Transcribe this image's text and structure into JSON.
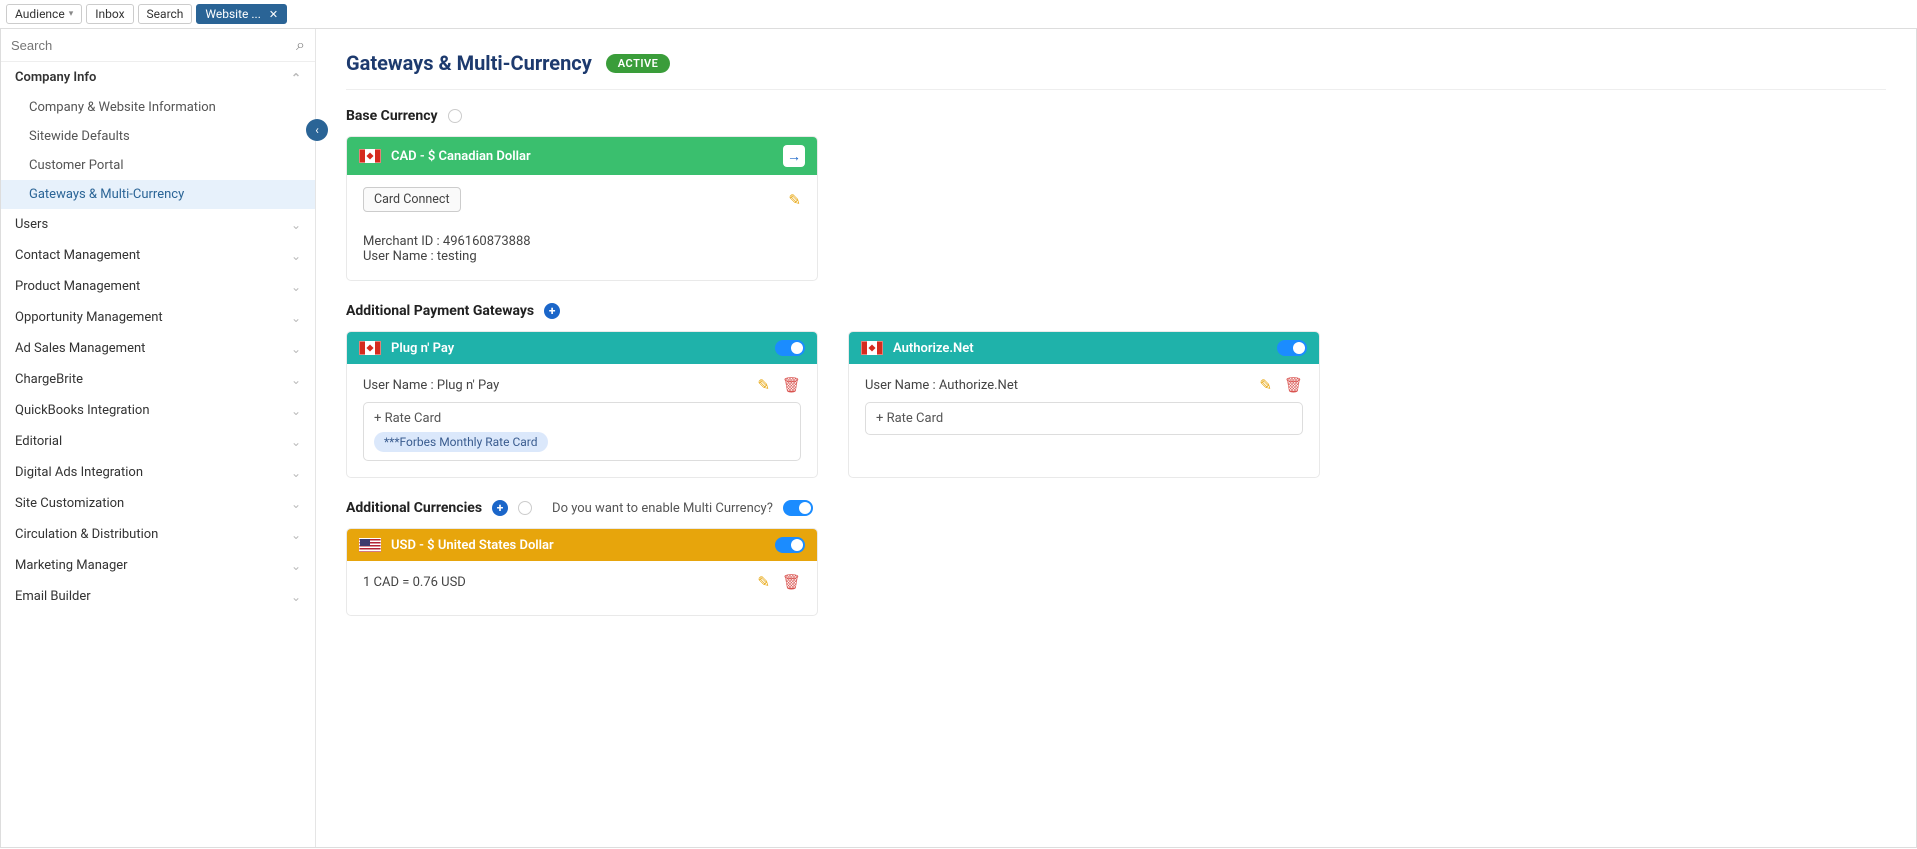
{
  "topTabs": {
    "audience": "Audience",
    "inbox": "Inbox",
    "search": "Search",
    "website": "Website ..."
  },
  "sidebar": {
    "searchPlaceholder": "Search",
    "group0": "Company Info",
    "sub0": "Company & Website Information",
    "sub1": "Sitewide Defaults",
    "sub2": "Customer Portal",
    "sub3": "Gateways & Multi-Currency",
    "groups": {
      "g1": "Users",
      "g2": "Contact Management",
      "g3": "Product Management",
      "g4": "Opportunity Management",
      "g5": "Ad Sales Management",
      "g6": "ChargeBrite",
      "g7": "QuickBooks Integration",
      "g8": "Editorial",
      "g9": "Digital Ads Integration",
      "g10": "Site Customization",
      "g11": "Circulation & Distribution",
      "g12": "Marketing Manager",
      "g13": "Email Builder"
    }
  },
  "page": {
    "title": "Gateways & Multi-Currency",
    "status": "ACTIVE",
    "sectionBase": "Base Currency",
    "sectionAddGateways": "Additional Payment Gateways",
    "sectionAddCurrencies": "Additional Currencies",
    "mcPrompt": "Do you want to enable Multi Currency?"
  },
  "base": {
    "headLabel": "CAD - $ Canadian Dollar",
    "chip": "Card Connect",
    "merchant": "Merchant ID : 496160873888",
    "username": "User Name : testing"
  },
  "gw1": {
    "head": "Plug n' Pay",
    "username": "User Name : Plug n' Pay",
    "rateAdd": "+  Rate Card",
    "rateTag": "***Forbes Monthly Rate Card"
  },
  "gw2": {
    "head": "Authorize.Net",
    "username": "User Name : Authorize.Net",
    "rateAdd": "+  Rate Card"
  },
  "cur1": {
    "head": "USD - $ United States Dollar",
    "rate": "1 CAD = 0.76 USD"
  }
}
